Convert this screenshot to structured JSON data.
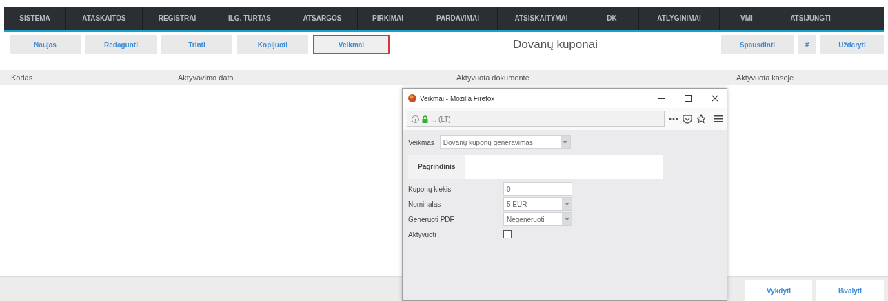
{
  "menu": [
    {
      "label": "SISTEMA"
    },
    {
      "label": "ATASKAITOS"
    },
    {
      "label": "REGISTRAI"
    },
    {
      "label": "ILG. TURTAS"
    },
    {
      "label": "ATSARGOS"
    },
    {
      "label": "PIRKIMAI"
    },
    {
      "label": "PARDAVIMAI"
    },
    {
      "label": "ATSISKAITYMAI"
    },
    {
      "label": "DK"
    },
    {
      "label": "ATLYGINIMAI"
    },
    {
      "label": "VMI"
    },
    {
      "label": "ATSIJUNGTI"
    }
  ],
  "toolbar": {
    "left": [
      {
        "label": "Naujas",
        "selected": false
      },
      {
        "label": "Redaguoti",
        "selected": false
      },
      {
        "label": "Trinti",
        "selected": false
      },
      {
        "label": "Kopijuoti",
        "selected": false
      },
      {
        "label": "Veikmai",
        "selected": true
      }
    ],
    "title": "Dovanų kuponai",
    "right": [
      {
        "label": "Spausdinti"
      },
      {
        "label": "#"
      },
      {
        "label": "Uždaryti"
      }
    ]
  },
  "table": {
    "columns": [
      "Kodas",
      "Aktyvavimo data",
      "Aktyvuota dokumente",
      "Aktyvuota kasoje"
    ]
  },
  "footer_buttons": [
    "Vykdyti",
    "Išvalyti"
  ],
  "popup": {
    "title": "Veikmai - Mozilla Firefox",
    "url": "... (LT)",
    "action_label": "Veikmas",
    "action_value": "Dovanų kuponų generavimas",
    "tabs": [
      {
        "label": "Pagrindinis",
        "selected": true
      }
    ],
    "fields": [
      {
        "kind": "input",
        "label": "Kuponų kiekis",
        "value": "0"
      },
      {
        "kind": "select",
        "label": "Nominalas",
        "value": "5 EUR"
      },
      {
        "kind": "select",
        "label": "Generuoti PDF",
        "value": "Negeneruoti"
      },
      {
        "kind": "checkbox",
        "label": "Aktyvuoti",
        "checked": false
      }
    ]
  }
}
